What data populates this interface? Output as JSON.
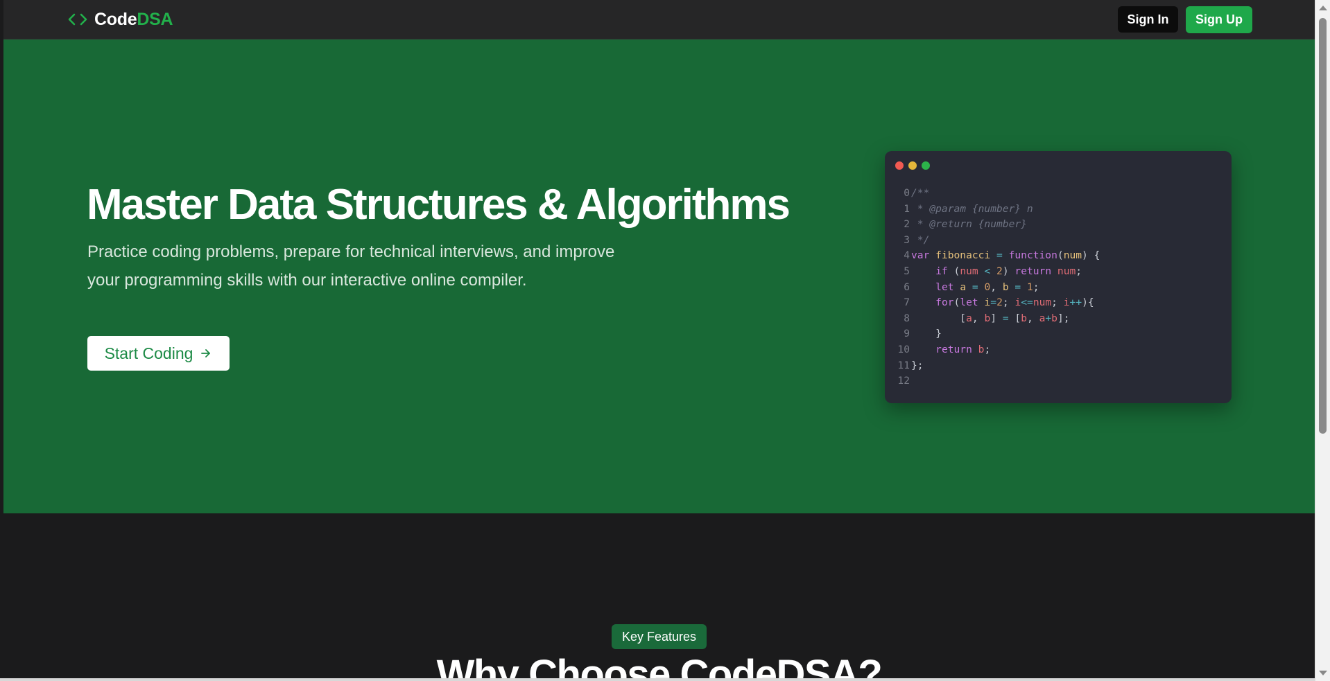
{
  "navbar": {
    "logo_prefix": "Code",
    "logo_accent": "DSA",
    "logo_icon": "code-brackets-icon",
    "sign_in_label": "Sign In",
    "sign_up_label": "Sign Up"
  },
  "hero": {
    "title": "Master Data Structures & Algorithms",
    "description": "Practice coding problems, prepare for technical interviews, and improve your programming skills with our interactive online compiler.",
    "cta_label": "Start Coding",
    "cta_icon": "arrow-right-icon"
  },
  "code_window": {
    "lines": [
      {
        "n": "0",
        "tokens": [
          [
            "c",
            "/**"
          ]
        ]
      },
      {
        "n": "1",
        "tokens": [
          [
            "c",
            " * @param {number} n"
          ]
        ]
      },
      {
        "n": "2",
        "tokens": [
          [
            "c",
            " * @return {number}"
          ]
        ]
      },
      {
        "n": "3",
        "tokens": [
          [
            "c",
            " */"
          ]
        ]
      },
      {
        "n": "4",
        "tokens": [
          [
            "k",
            "var "
          ],
          [
            "f",
            "fibonacci"
          ],
          [
            "o",
            " = "
          ],
          [
            "k",
            "function"
          ],
          [
            "p",
            "("
          ],
          [
            "f",
            "num"
          ],
          [
            "p",
            ") {"
          ]
        ]
      },
      {
        "n": "5",
        "tokens": [
          [
            "p",
            "    "
          ],
          [
            "k",
            "if "
          ],
          [
            "p",
            "("
          ],
          [
            "v",
            "num"
          ],
          [
            "o",
            " < "
          ],
          [
            "n",
            "2"
          ],
          [
            "p",
            ") "
          ],
          [
            "k",
            "return "
          ],
          [
            "v",
            "num"
          ],
          [
            "p",
            ";"
          ]
        ]
      },
      {
        "n": "6",
        "tokens": [
          [
            "p",
            "    "
          ],
          [
            "k",
            "let "
          ],
          [
            "f",
            "a"
          ],
          [
            "o",
            " = "
          ],
          [
            "n",
            "0"
          ],
          [
            "p",
            ", "
          ],
          [
            "f",
            "b"
          ],
          [
            "o",
            " = "
          ],
          [
            "n",
            "1"
          ],
          [
            "p",
            ";"
          ]
        ]
      },
      {
        "n": "7",
        "tokens": [
          [
            "p",
            "    "
          ],
          [
            "k",
            "for"
          ],
          [
            "p",
            "("
          ],
          [
            "k",
            "let "
          ],
          [
            "f",
            "i"
          ],
          [
            "o",
            "="
          ],
          [
            "n",
            "2"
          ],
          [
            "p",
            "; "
          ],
          [
            "v",
            "i"
          ],
          [
            "o",
            "<="
          ],
          [
            "v",
            "num"
          ],
          [
            "p",
            "; "
          ],
          [
            "v",
            "i"
          ],
          [
            "o",
            "++"
          ],
          [
            "p",
            "){"
          ]
        ]
      },
      {
        "n": "8",
        "tokens": [
          [
            "p",
            "        ["
          ],
          [
            "v",
            "a"
          ],
          [
            "p",
            ", "
          ],
          [
            "v",
            "b"
          ],
          [
            "p",
            "] "
          ],
          [
            "o",
            "="
          ],
          [
            "p",
            " ["
          ],
          [
            "v",
            "b"
          ],
          [
            "p",
            ", "
          ],
          [
            "v",
            "a"
          ],
          [
            "o",
            "+"
          ],
          [
            "v",
            "b"
          ],
          [
            "p",
            "];"
          ]
        ]
      },
      {
        "n": "9",
        "tokens": [
          [
            "p",
            "    }"
          ]
        ]
      },
      {
        "n": "10",
        "tokens": [
          [
            "p",
            "    "
          ],
          [
            "k",
            "return "
          ],
          [
            "v",
            "b"
          ],
          [
            "p",
            ";"
          ]
        ]
      },
      {
        "n": "11",
        "tokens": [
          [
            "p",
            "};"
          ]
        ]
      },
      {
        "n": "12",
        "tokens": [
          [
            "p",
            ""
          ]
        ]
      }
    ]
  },
  "features": {
    "badge": "Key Features",
    "title": "Why Choose CodeDSA?"
  },
  "colors": {
    "brand_green": "#1fa84a",
    "hero_bg": "#186936",
    "page_bg": "#1b1b1c"
  }
}
